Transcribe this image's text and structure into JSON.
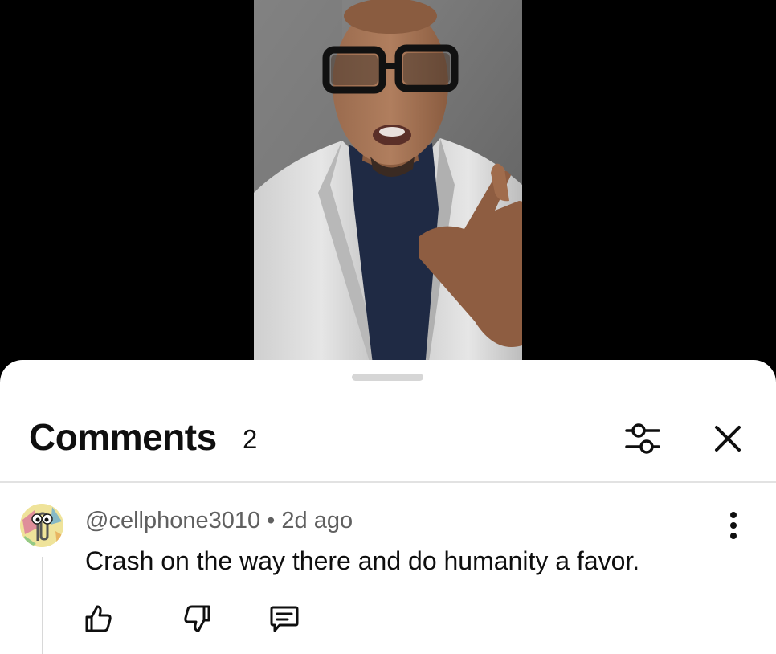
{
  "video": {
    "description_icon": "video-frame"
  },
  "comments_panel": {
    "title": "Comments",
    "count": "2",
    "filter_icon": "filter-icon",
    "close_icon": "close-icon"
  },
  "comments": [
    {
      "author": "@cellphone3010",
      "separator": "•",
      "time": "2d ago",
      "text": "Crash on the way there and do humanity a favor.",
      "avatar_icon": "paperclip-avatar",
      "more_icon": "more-vertical-icon",
      "like_icon": "thumbs-up-icon",
      "dislike_icon": "thumbs-down-icon",
      "reply_icon": "reply-icon"
    }
  ],
  "colors": {
    "background": "#000000",
    "sheet": "#ffffff",
    "primary_text": "#0f0f0f",
    "secondary_text": "#606060",
    "divider": "#e2e2e2"
  }
}
